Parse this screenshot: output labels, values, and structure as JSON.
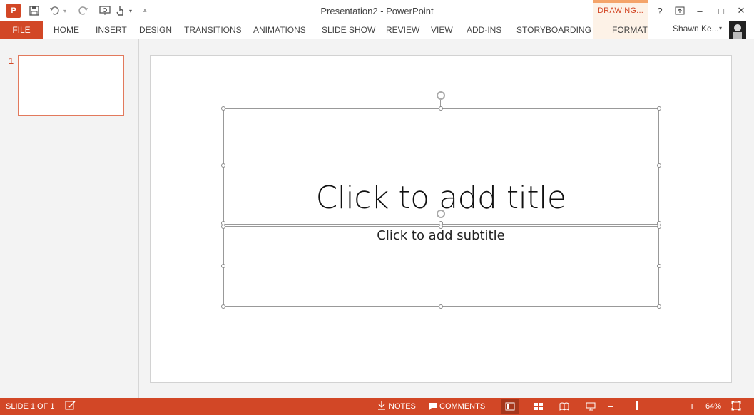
{
  "window": {
    "title": "Presentation2 - PowerPoint",
    "context_group": "DRAWING...",
    "user": "Shawn Ke..."
  },
  "quick_access": {
    "save_icon": "save-icon",
    "undo_icon": "undo-icon",
    "redo_icon": "redo-icon",
    "present_icon": "present-icon",
    "touch_icon": "touch-icon",
    "customize_icon": "customize-icon"
  },
  "window_controls": {
    "help": "?",
    "restore_ribbon": "⇱",
    "minimize": "–",
    "maximize": "□",
    "close": "✕"
  },
  "ribbon": {
    "file": "FILE",
    "tabs": [
      "HOME",
      "INSERT",
      "DESIGN",
      "TRANSITIONS",
      "ANIMATIONS",
      "SLIDE SHOW",
      "REVIEW",
      "VIEW",
      "ADD-INS",
      "STORYBOARDING",
      "FORMAT"
    ]
  },
  "thumbnails": {
    "slide_number": "1"
  },
  "slide": {
    "title_placeholder": "Click to add title",
    "subtitle_placeholder": "Click to add subtitle"
  },
  "status": {
    "slide_info": "SLIDE 1 OF 1",
    "notes": "NOTES",
    "comments": "COMMENTS",
    "zoom_minus": "–",
    "zoom_plus": "+",
    "zoom": "64%",
    "zoom_level_percent": 64
  },
  "colors": {
    "accent": "#d24726",
    "context_tab": "#fdf2e7"
  }
}
